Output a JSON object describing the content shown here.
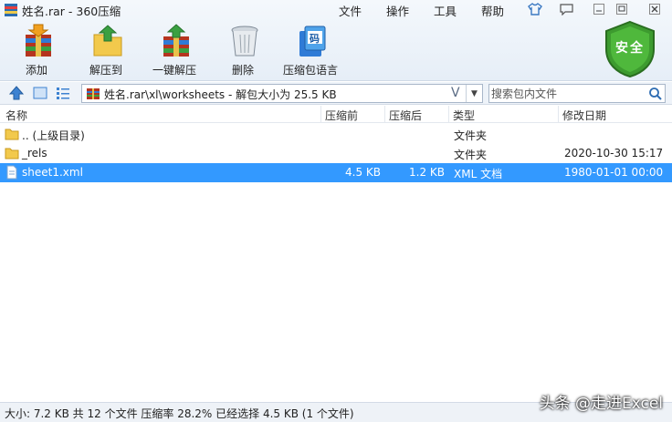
{
  "window": {
    "title": "姓名.rar - 360压缩"
  },
  "menu": [
    "文件",
    "操作",
    "工具",
    "帮助"
  ],
  "toolbar": [
    {
      "label": "添加",
      "icon": "add-archive-icon"
    },
    {
      "label": "解压到",
      "icon": "extract-to-icon"
    },
    {
      "label": "一键解压",
      "icon": "one-click-extract-icon"
    },
    {
      "label": "删除",
      "icon": "delete-trash-icon"
    },
    {
      "label": "压缩包语言",
      "icon": "archive-language-icon",
      "badge": "码"
    }
  ],
  "security": {
    "label": "安全"
  },
  "address": {
    "path": "姓名.rar\\xl\\worksheets - 解包大小为 25.5 KB",
    "v_symbol": "V"
  },
  "search": {
    "placeholder": "搜索包内文件"
  },
  "columns": {
    "name": "名称",
    "compressed": "压缩前",
    "packed": "压缩后",
    "type": "类型",
    "modified": "修改日期"
  },
  "rows": [
    {
      "name": ".. (上级目录)",
      "before": "",
      "after": "",
      "type": "文件夹",
      "date": "",
      "icon": "folder-icon"
    },
    {
      "name": "_rels",
      "before": "",
      "after": "",
      "type": "文件夹",
      "date": "2020-10-30 15:17",
      "icon": "folder-icon"
    },
    {
      "name": "sheet1.xml",
      "before": "4.5 KB",
      "after": "1.2 KB",
      "type": "XML 文档",
      "date": "1980-01-01 00:00",
      "icon": "xml-file-icon",
      "selected": true
    }
  ],
  "status": {
    "text": "大小: 7.2 KB 共 12 个文件 压缩率 28.2% 已经选择 4.5 KB (1 个文件)"
  },
  "watermark": "头条 @走进Excel",
  "colors": {
    "selection": "#3399ff",
    "shield": "#3d9b2f"
  }
}
